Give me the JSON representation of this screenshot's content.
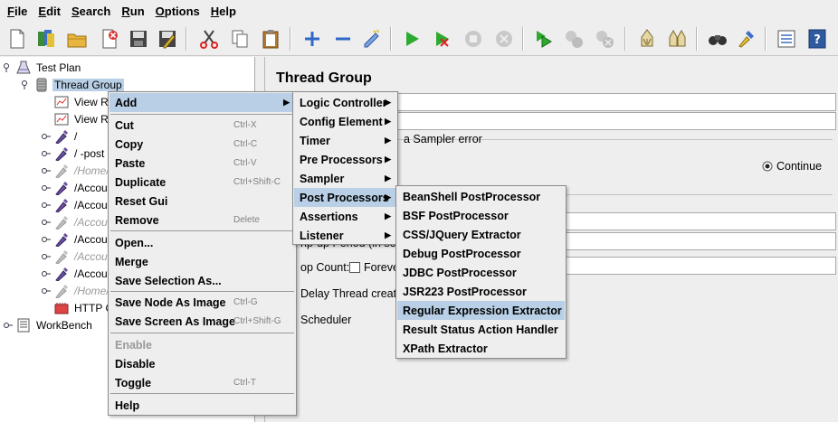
{
  "menubar": [
    "File",
    "Edit",
    "Search",
    "Run",
    "Options",
    "Help"
  ],
  "toolbar": {
    "buttons": [
      "new-icon",
      "templates-icon",
      "open-icon",
      "close-icon",
      "save-icon",
      "save-as-icon",
      "cut-icon",
      "copy-icon",
      "paste-icon",
      "expand-icon",
      "collapse-icon",
      "toggle-icon",
      "start-icon",
      "start-no-pauses-icon",
      "stop-icon",
      "shutdown-icon",
      "remote-start-icon",
      "remote-stop-icon",
      "remote-shutdown-icon",
      "clear-icon",
      "clear-all-icon",
      "search-icon",
      "reset-search-icon",
      "function-helper-icon",
      "help-icon"
    ]
  },
  "tree": {
    "nodes": [
      {
        "label": "Test Plan",
        "icon": "test-plan-icon"
      },
      {
        "label": "Thread Group",
        "icon": "thread-group-icon"
      },
      {
        "label": "View R",
        "icon": "listener-icon"
      },
      {
        "label": "View R",
        "icon": "listener-icon"
      },
      {
        "label": "/",
        "icon": "sampler-icon"
      },
      {
        "label": "/ -post",
        "icon": "sampler-icon"
      },
      {
        "label": "/Home/I",
        "icon": "sampler-icon"
      },
      {
        "label": "/Accou",
        "icon": "sampler-icon"
      },
      {
        "label": "/Accou",
        "icon": "sampler-icon"
      },
      {
        "label": "/Accou",
        "icon": "sampler-icon"
      },
      {
        "label": "/Accou",
        "icon": "sampler-icon"
      },
      {
        "label": "/Accou",
        "icon": "sampler-icon"
      },
      {
        "label": "/Accou",
        "icon": "sampler-icon"
      },
      {
        "label": "/Home/I",
        "icon": "sampler-icon"
      },
      {
        "label": "HTTP C",
        "icon": "config-icon"
      },
      {
        "label": "WorkBench",
        "icon": "workbench-icon"
      }
    ]
  },
  "panel": {
    "title": "Thread Group",
    "sampler_error_text": "a Sampler error",
    "continue_label": "Continue",
    "rampup_fragment": "np-up Period (in se",
    "loop_count_label": "op Count:",
    "forever_label": "Foreve",
    "delay_label": "Delay Thread creat",
    "scheduler_label": "Scheduler"
  },
  "context_menu": {
    "items": [
      {
        "label": "Add",
        "shortcut": ""
      },
      {
        "label": "Cut",
        "shortcut": "Ctrl-X"
      },
      {
        "label": "Copy",
        "shortcut": "Ctrl-C"
      },
      {
        "label": "Paste",
        "shortcut": "Ctrl-V"
      },
      {
        "label": "Duplicate",
        "shortcut": "Ctrl+Shift-C"
      },
      {
        "label": "Reset Gui",
        "shortcut": ""
      },
      {
        "label": "Remove",
        "shortcut": "Delete"
      },
      {
        "label": "Open...",
        "shortcut": ""
      },
      {
        "label": "Merge",
        "shortcut": ""
      },
      {
        "label": "Save Selection As...",
        "shortcut": ""
      },
      {
        "label": "Save Node As Image",
        "shortcut": "Ctrl-G"
      },
      {
        "label": "Save Screen As Image",
        "shortcut": "Ctrl+Shift-G"
      },
      {
        "label": "Enable",
        "shortcut": ""
      },
      {
        "label": "Disable",
        "shortcut": ""
      },
      {
        "label": "Toggle",
        "shortcut": "Ctrl-T"
      },
      {
        "label": "Help",
        "shortcut": ""
      }
    ]
  },
  "add_menu": {
    "items": [
      "Logic Controller",
      "Config Element",
      "Timer",
      "Pre Processors",
      "Sampler",
      "Post Processors",
      "Assertions",
      "Listener"
    ]
  },
  "post_processors_menu": {
    "items": [
      "BeanShell PostProcessor",
      "BSF PostProcessor",
      "CSS/JQuery Extractor",
      "Debug PostProcessor",
      "JDBC PostProcessor",
      "JSR223 PostProcessor",
      "Regular Expression Extractor",
      "Result Status Action Handler",
      "XPath Extractor"
    ]
  },
  "colors": {
    "highlight": "#b8cfe5",
    "menu_bg": "#eeeeee",
    "tree_bg": "#ffffff"
  }
}
